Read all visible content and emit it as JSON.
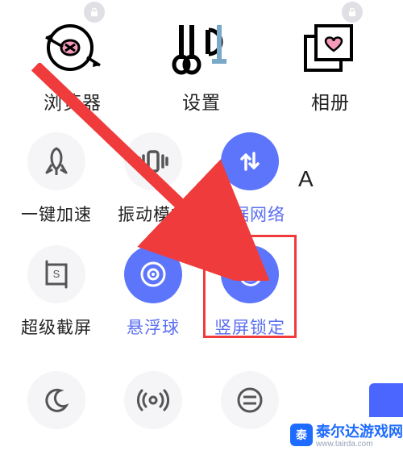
{
  "apps": [
    {
      "key": "browser",
      "label": "浏览器",
      "locked": true
    },
    {
      "key": "settings",
      "label": "设置",
      "locked": false
    },
    {
      "key": "gallery",
      "label": "相册",
      "locked": true
    }
  ],
  "toggles_row1": [
    {
      "key": "boost",
      "label": "一键加速",
      "active": false
    },
    {
      "key": "vibrate",
      "label": "振动模式",
      "active": false
    },
    {
      "key": "data",
      "label": "数据网络",
      "active": true
    }
  ],
  "font_button": {
    "label": "A"
  },
  "toggles_row2": [
    {
      "key": "sshot",
      "label": "超级截屏",
      "active": false
    },
    {
      "key": "float",
      "label": "悬浮球",
      "active": true
    },
    {
      "key": "rotate",
      "label": "竖屏锁定",
      "active": true,
      "highlight": true
    }
  ],
  "toggles_row3": [
    {
      "key": "night"
    },
    {
      "key": "hotspot"
    },
    {
      "key": "more"
    }
  ],
  "watermark": {
    "badge": "泰",
    "title": "泰尔达游戏网",
    "url": "www.tairda.com"
  },
  "colors": {
    "blue_active": "#5d75fa",
    "highlight_red": "#ef3b3b"
  }
}
